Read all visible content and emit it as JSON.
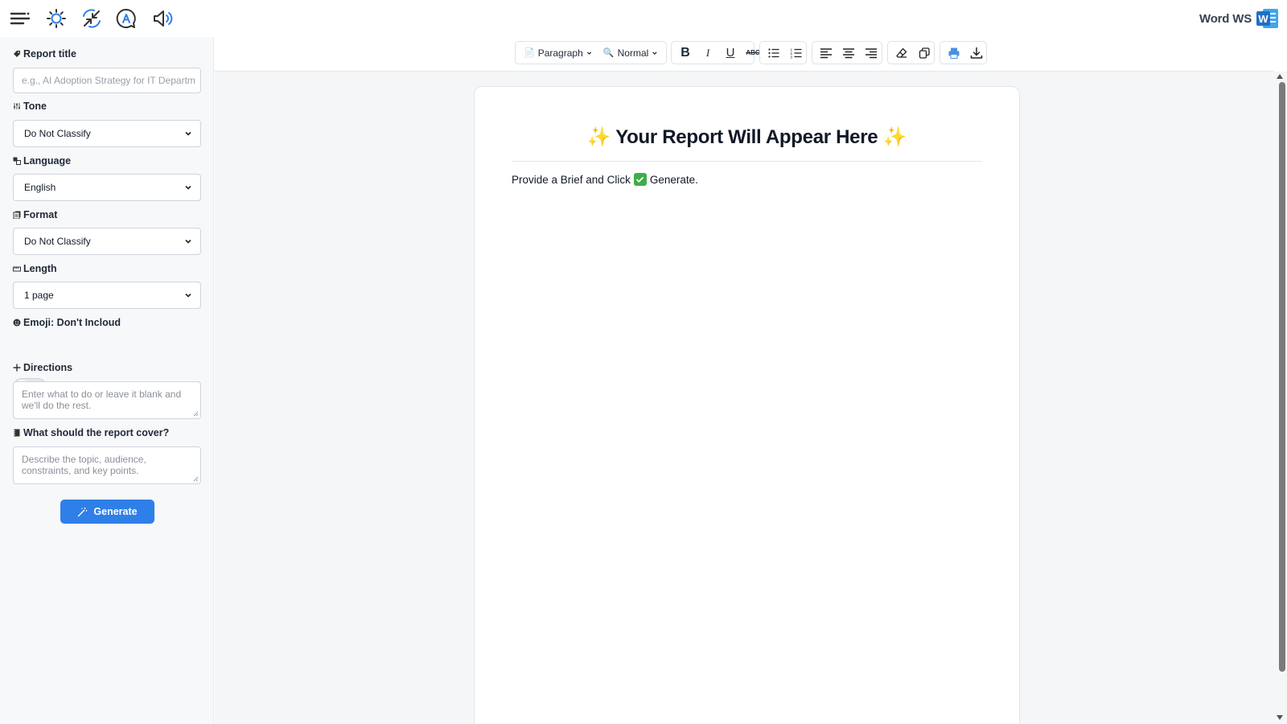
{
  "topbar": {
    "icons": [
      "menu-icon",
      "theme-sun-icon",
      "collapse-arrows-icon",
      "auto-text-icon",
      "speaker-icon"
    ],
    "brand_text": "Word WS",
    "brand_logo_letter": "W"
  },
  "sidebar": {
    "report_title_label": "Report title",
    "report_title_placeholder": "e.g., AI Adoption Strategy for IT Departm",
    "tone_label": "Tone",
    "tone_value": "Do Not Classify",
    "language_label": "Language",
    "language_value": "English",
    "format_label": "Format",
    "format_value": "Do Not Classify",
    "length_label": "Length",
    "length_value": "1 page",
    "emoji_label": "Emoji: Don't Incloud",
    "emoji_enabled": false,
    "directions_label": "Directions",
    "directions_placeholder": "Enter what to do or leave it blank and we'll do the rest.",
    "cover_label": "What should the report cover?",
    "cover_placeholder": "Describe the topic, audience, constraints, and key points.",
    "generate_label": "Generate"
  },
  "toolbar": {
    "block_format_prefix": "📄",
    "block_format": "Paragraph",
    "zoom_prefix": "🔍",
    "zoom": "Normal",
    "bold": "B",
    "italic": "I",
    "underline": "U",
    "strike": "ABC"
  },
  "document": {
    "title_spark": "✨",
    "title_text": "Your Report Will Appear Here",
    "body_before": "Provide a Brief and Click",
    "body_after": "Generate."
  },
  "colors": {
    "accent": "#2f7fe8",
    "brand_blue": "#1f6fc5",
    "check_green": "#3fae49",
    "spark_yellow": "#f2b705"
  }
}
